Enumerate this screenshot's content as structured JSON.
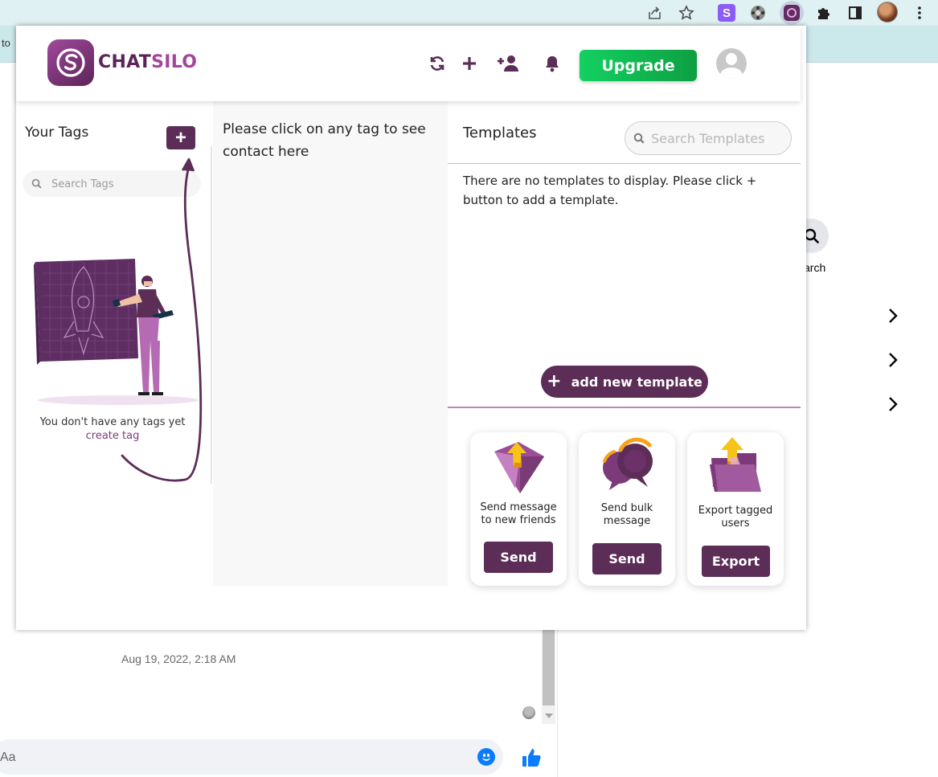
{
  "browser": {
    "bookmark_fragment": "to",
    "extension_s_label": "S",
    "icons": [
      "share-icon",
      "star-icon",
      "extension-s-icon",
      "film-reel-icon",
      "chatsilo-extension-icon",
      "puzzle-icon",
      "side-panel-icon",
      "profile-avatar",
      "more-vertical-icon"
    ]
  },
  "background_page": {
    "timestamp": "Aug 19, 2022, 2:18 AM",
    "message_placeholder": "Aa",
    "search_label": "arch"
  },
  "header": {
    "brand_part1": "CHAT",
    "brand_part2": "SILO",
    "upgrade_label": "Upgrade",
    "icons": [
      "refresh-icon",
      "plus-icon",
      "add-user-icon",
      "bell-icon"
    ]
  },
  "tags": {
    "title": "Your Tags",
    "add_label": "+",
    "search_placeholder": "Search Tags",
    "empty_text": "You don't have any tags yet",
    "create_link": "create tag"
  },
  "contacts": {
    "message": "Please click on any tag to see contact here"
  },
  "templates": {
    "title": "Templates",
    "search_placeholder": "Search Templates",
    "empty_text": "There are no templates to display. Please click + button to add a template.",
    "add_icon": "+",
    "add_label": "add new template"
  },
  "actions": [
    {
      "text": "Send message to new friends",
      "button": "Send"
    },
    {
      "text": "Send bulk message",
      "button": "Send"
    },
    {
      "text": "Export tagged users",
      "button": "Export"
    }
  ],
  "colors": {
    "brand_purple": "#5b2d57",
    "brand_pink": "#a5449d",
    "upgrade_green": "#12d161",
    "messenger_blue": "#0a7cff"
  }
}
